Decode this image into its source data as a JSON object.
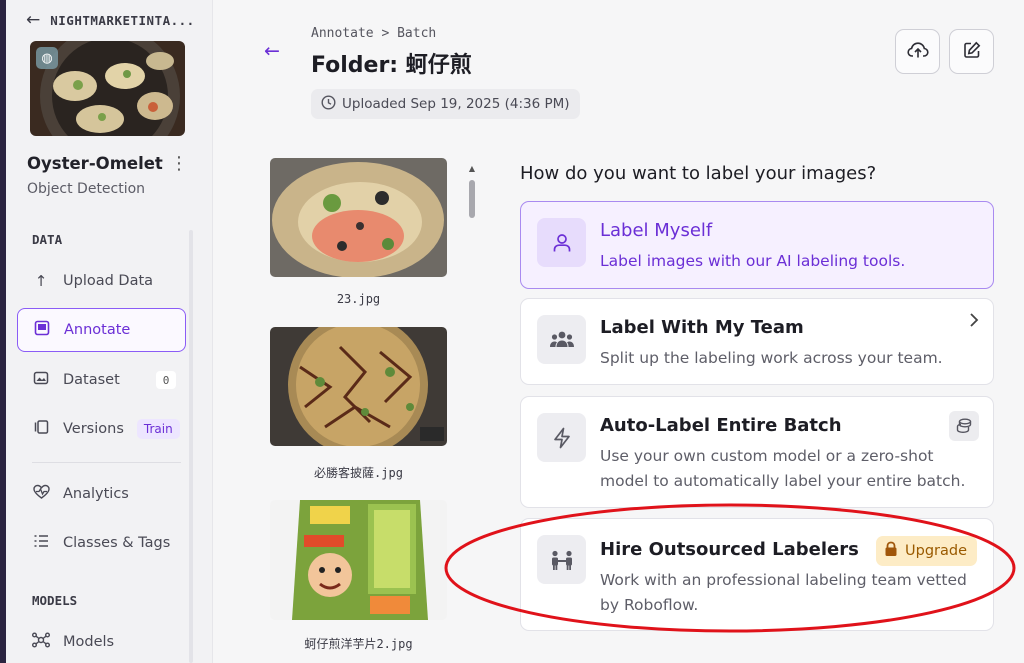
{
  "workspace": {
    "name": "NIGHTMARKETINTA...",
    "back_icon": "arrow-left-icon"
  },
  "project": {
    "name": "Oyster-Omelet",
    "type": "Object Detection",
    "menu": "⋮"
  },
  "sidebar": {
    "data_section": "DATA",
    "models_section": "MODELS",
    "items": [
      {
        "label": "Upload Data",
        "icon": "upload-icon"
      },
      {
        "label": "Annotate",
        "icon": "annotate-icon",
        "active": true
      },
      {
        "label": "Dataset",
        "icon": "dataset-icon",
        "badge": "0"
      },
      {
        "label": "Versions",
        "icon": "versions-icon",
        "badge": "Train"
      },
      {
        "label": "Analytics",
        "icon": "analytics-icon"
      },
      {
        "label": "Classes & Tags",
        "icon": "classes-icon"
      },
      {
        "label": "Models",
        "icon": "models-icon"
      }
    ]
  },
  "header": {
    "breadcrumb": "Annotate > Batch",
    "title": "Folder: 蚵仔煎",
    "uploaded": "Uploaded Sep 19, 2025 (4:36 PM)"
  },
  "thumbnails": [
    {
      "filename": "23.jpg"
    },
    {
      "filename": "必勝客披薩.jpg"
    },
    {
      "filename": "蚵仔煎洋芋片2.jpg"
    }
  ],
  "question": "How do you want to label your images?",
  "options": [
    {
      "title": "Label Myself",
      "desc": "Label images with our AI labeling tools.",
      "icon": "person-icon"
    },
    {
      "title": "Label With My Team",
      "desc": "Split up the labeling work across your team.",
      "icon": "team-icon"
    },
    {
      "title": "Auto-Label Entire Batch",
      "desc": "Use your own custom model or a zero-shot model to automatically label your entire batch.",
      "icon": "lightning-icon"
    },
    {
      "title": "Hire Outsourced Labelers",
      "desc": "Work with an professional labeling team vetted by Roboflow.",
      "icon": "labelers-icon",
      "badge": "Upgrade"
    }
  ],
  "colors": {
    "accent": "#6b2fd6",
    "upgrade_bg": "#fdecc6",
    "highlight_ring": "#e0121a"
  }
}
